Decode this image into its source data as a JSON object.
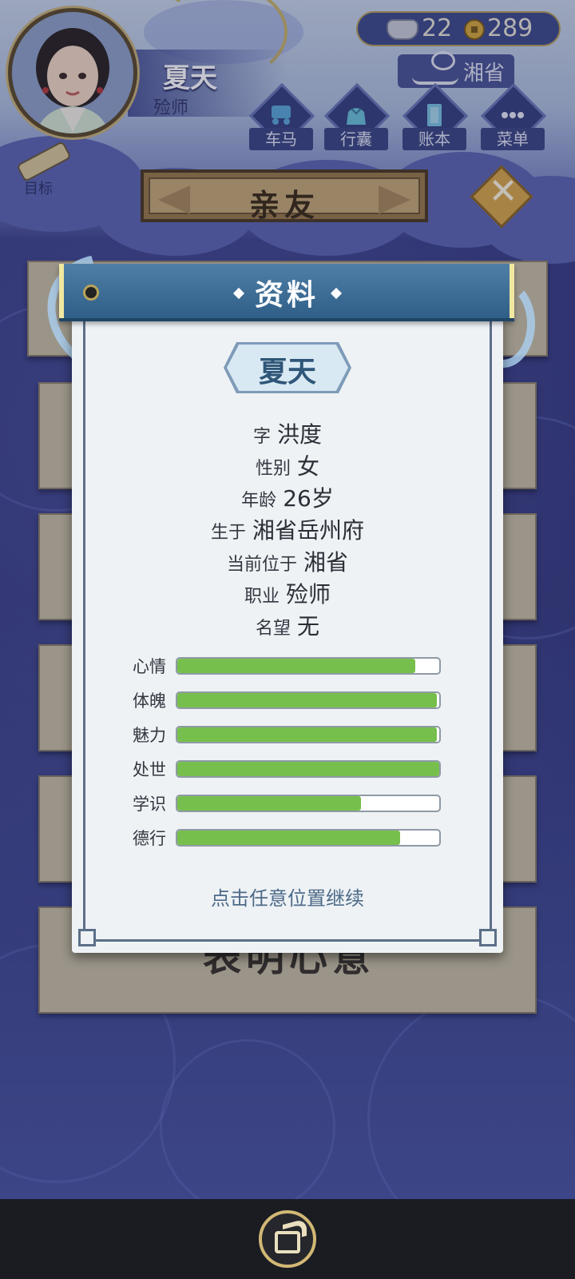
{
  "player": {
    "name": "夏天",
    "job": "殓师"
  },
  "currency": {
    "silver": "22",
    "copper": "289"
  },
  "location": "湘省",
  "menu": [
    {
      "label": "车马",
      "icon": "carriage-icon"
    },
    {
      "label": "行囊",
      "icon": "bag-icon"
    },
    {
      "label": "账本",
      "icon": "ledger-icon"
    },
    {
      "label": "菜单",
      "icon": "more-icon"
    }
  ],
  "target_label": "目标",
  "section_title": "亲友",
  "close_glyph": "✕",
  "background_card_text": "表明心意",
  "dialog": {
    "title": "资料",
    "name": "夏天",
    "info": [
      {
        "key": "字",
        "value": "洪度"
      },
      {
        "key": "性别",
        "value": "女"
      },
      {
        "key": "年龄",
        "value": "26岁"
      },
      {
        "key": "生于",
        "value": "湘省岳州府"
      },
      {
        "key": "当前位于",
        "value": "湘省"
      },
      {
        "key": "职业",
        "value": "殓师"
      },
      {
        "key": "名望",
        "value": "无"
      }
    ],
    "stats": [
      {
        "label": "心情",
        "value": 0.91
      },
      {
        "label": "体魄",
        "value": 0.99
      },
      {
        "label": "魅力",
        "value": 0.99
      },
      {
        "label": "处世",
        "value": 1.0
      },
      {
        "label": "学识",
        "value": 0.7
      },
      {
        "label": "德行",
        "value": 0.85
      }
    ],
    "continue_hint": "点击任意位置继续"
  },
  "colors": {
    "bar_fill": "#77bf4c",
    "header": "#3a6b94",
    "gold": "#c9b277"
  }
}
